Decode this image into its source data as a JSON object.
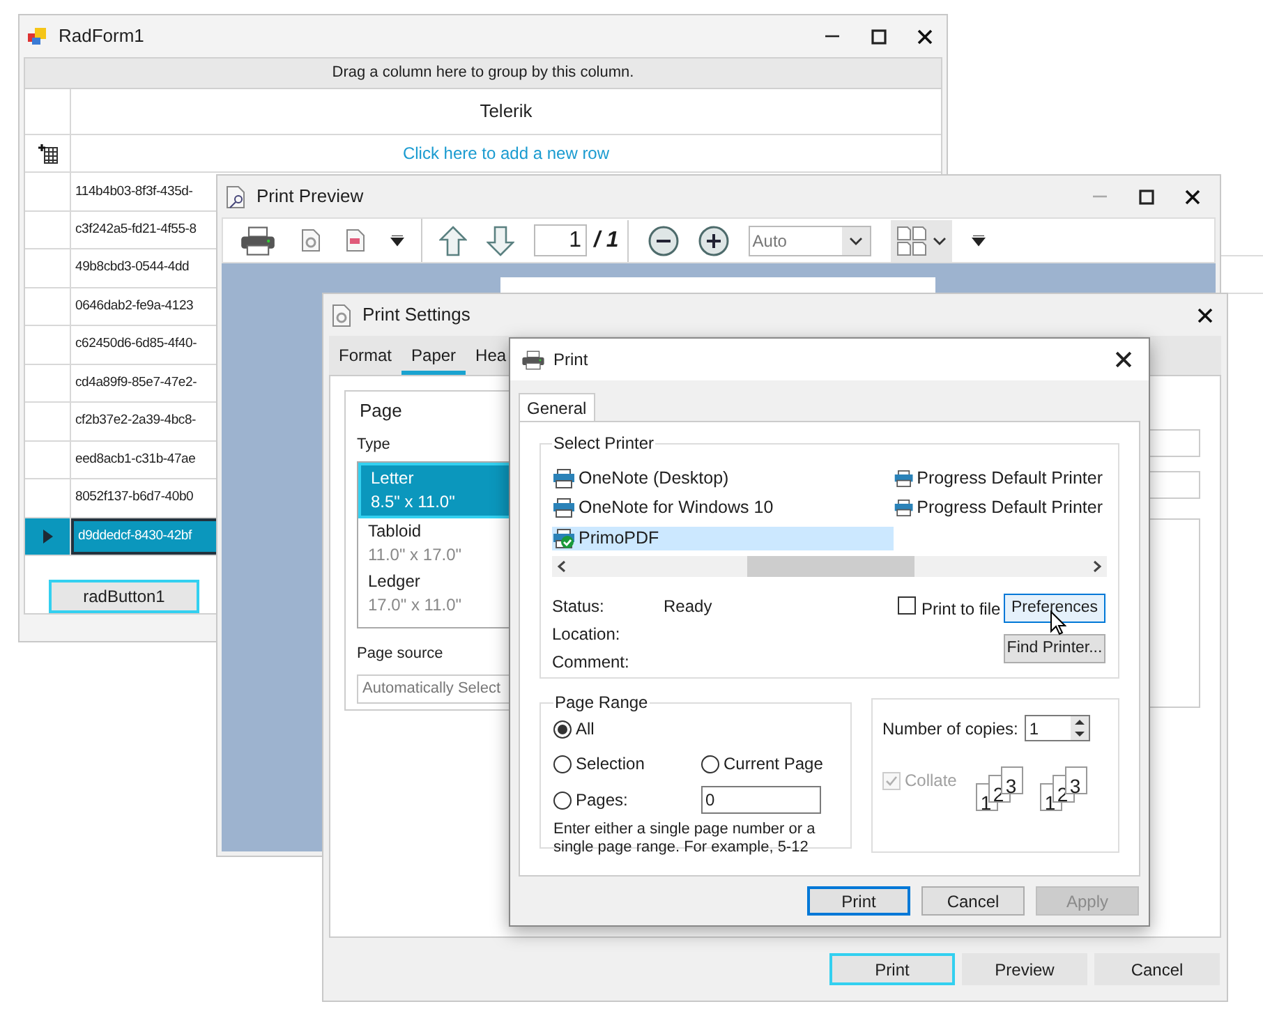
{
  "radform": {
    "title": "RadForm1",
    "group_panel": "Drag a column here to group by this column.",
    "column_header": "Telerik",
    "new_row": "Click here to add a new row",
    "rows": [
      {
        "cell": "114b4b03-8f3f-435d-",
        "selected": false
      },
      {
        "cell": "c3f242a5-fd21-4f55-8",
        "selected": false
      },
      {
        "cell": "49b8cbd3-0544-4dd",
        "selected": false
      },
      {
        "cell": "0646dab2-fe9a-4123",
        "selected": false
      },
      {
        "cell": "c62450d6-6d85-4f40-",
        "selected": false
      },
      {
        "cell": "cd4a89f9-85e7-47e2-",
        "selected": false
      },
      {
        "cell": "cf2b37e2-2a39-4bc8-",
        "selected": false
      },
      {
        "cell": "eed8acb1-c31b-47ae",
        "selected": false
      },
      {
        "cell": "8052f137-b6d7-40b0",
        "selected": false
      },
      {
        "cell": "d9ddedcf-8430-42bf",
        "selected": true
      }
    ],
    "button": "radButton1"
  },
  "print_preview": {
    "title": "Print Preview",
    "page_field": "1",
    "page_total": "/ 1",
    "zoom": "Auto"
  },
  "print_settings": {
    "title": "Print Settings",
    "tabs": [
      {
        "label": "Format",
        "selected": false
      },
      {
        "label": "Paper",
        "selected": true
      },
      {
        "label": "Hea",
        "selected": false
      }
    ],
    "page_group": "Page",
    "type_label": "Type",
    "paper_types": [
      {
        "name": "Letter",
        "size": "8.5\" x 11.0\"",
        "selected": true
      },
      {
        "name": "Tabloid",
        "size": "11.0\" x 17.0\"",
        "selected": false
      },
      {
        "name": "Ledger",
        "size": "17.0\" x 11.0\"",
        "selected": false
      }
    ],
    "page_source_label": "Page source",
    "page_source": "Automatically Select",
    "buttons": [
      {
        "label": "Print",
        "kind": "focused"
      },
      {
        "label": "Preview",
        "kind": "normal"
      },
      {
        "label": "Cancel",
        "kind": "normal"
      }
    ]
  },
  "print_dialog": {
    "title": "Print",
    "tabs": [
      {
        "label": "General",
        "selected": true
      }
    ],
    "select_printer": "Select Printer",
    "printers": [
      {
        "name": "OneNote (Desktop)",
        "selected": false,
        "default": false
      },
      {
        "name": "OneNote for Windows 10",
        "selected": false,
        "default": false
      },
      {
        "name": "PrimoPDF",
        "selected": true,
        "default": true
      },
      {
        "name": "Progress Default Printer",
        "selected": false,
        "default": false
      },
      {
        "name": "Progress Default Printer",
        "selected": false,
        "default": false
      }
    ],
    "status_label": "Status:",
    "status": "Ready",
    "location_label": "Location:",
    "comment_label": "Comment:",
    "print_to_file": {
      "label": "Print to file",
      "checked": false
    },
    "preferences": "Preferences",
    "find_printer": "Find Printer...",
    "page_range": {
      "title": "Page Range",
      "options": [
        {
          "label": "All",
          "selected": true
        },
        {
          "label": "Selection",
          "selected": false
        },
        {
          "label": "Current Page",
          "selected": false
        },
        {
          "label": "Pages:",
          "selected": false
        }
      ],
      "pages_value": "0",
      "hint": "Enter either a single page number or a single page range.  For example, 5-12"
    },
    "copies_label": "Number of copies:",
    "copies": "1",
    "collate": {
      "label": "Collate",
      "checked": true,
      "disabled": true
    },
    "collate_sets": [
      [
        "1",
        "2",
        "3"
      ],
      [
        "1",
        "2",
        "3"
      ]
    ],
    "buttons": [
      {
        "label": "Print",
        "kind": "default"
      },
      {
        "label": "Cancel",
        "kind": "normal"
      },
      {
        "label": "Apply",
        "kind": "disabled"
      }
    ]
  }
}
